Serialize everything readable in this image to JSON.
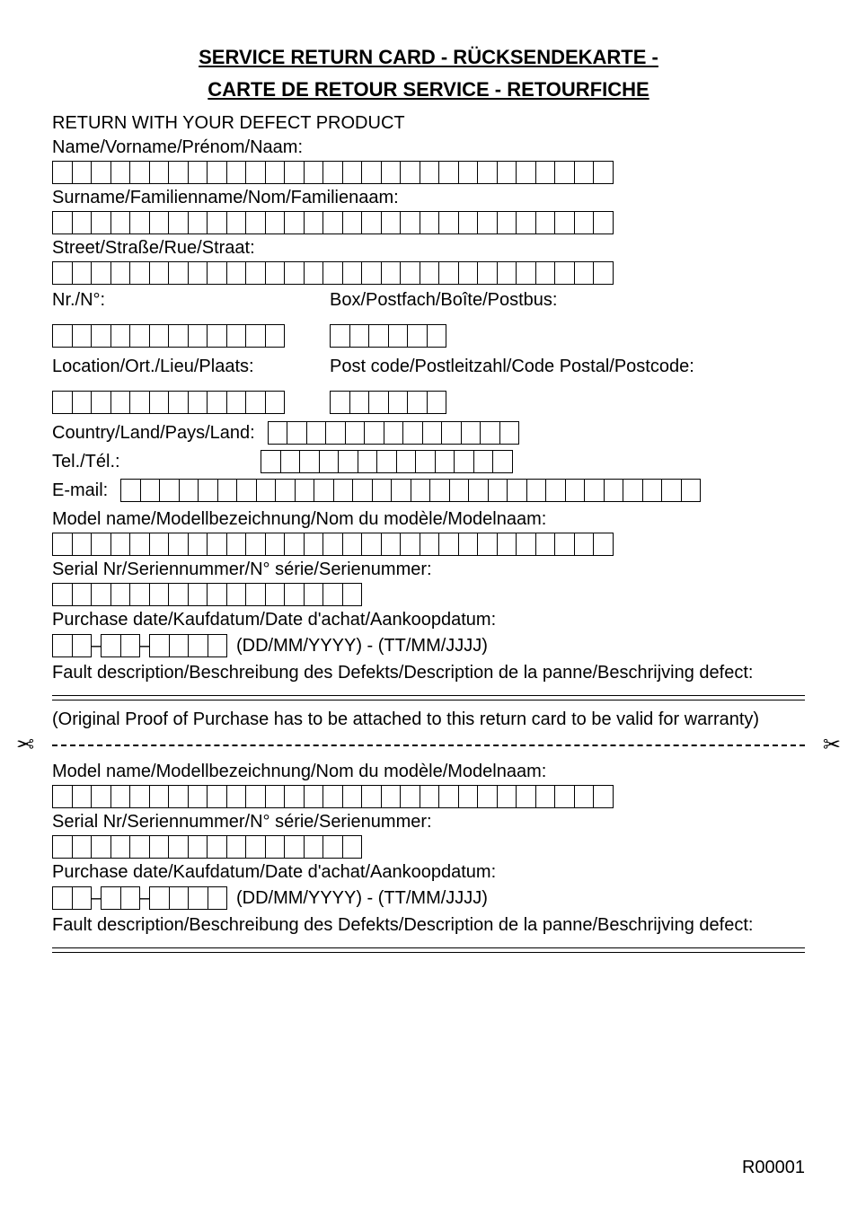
{
  "title1": "SERVICE RETURN CARD - RÜCKSENDEKARTE -",
  "title2": "CARTE DE RETOUR SERVICE - RETOURFICHE",
  "return_with": "RETURN WITH YOUR DEFECT PRODUCT",
  "labels": {
    "name": "Name/Vorname/Prénom/Naam:",
    "surname": "Surname/Familienname/Nom/Familienaam:",
    "street": "Street/Straße/Rue/Straat:",
    "nr": "Nr./N°:",
    "box": "Box/Postfach/Boîte/Postbus:",
    "location": "Location/Ort./Lieu/Plaats:",
    "postcode": "Post code/Postleitzahl/Code Postal/Postcode:",
    "country": "Country/Land/Pays/Land:",
    "tel": "Tel./Tél.:",
    "email": "E-mail:",
    "model": "Model name/Modellbezeichnung/Nom du modèle/Modelnaam:",
    "serial": "Serial Nr/Seriennummer/N° série/Serienummer:",
    "purchase": "Purchase date/Kaufdatum/Date d'achat/Aankoopdatum:",
    "dateformat": "(DD/MM/YYYY) - (TT/MM/JJJJ)",
    "fault": "Fault description/Beschreibung des Defekts/Description de la panne/Beschrijving defect:",
    "originalproof": "(Original Proof of Purchase has to be attached to this return card to be valid for warranty)"
  },
  "footer": "R00001",
  "scissors": "✂",
  "dash": "–"
}
